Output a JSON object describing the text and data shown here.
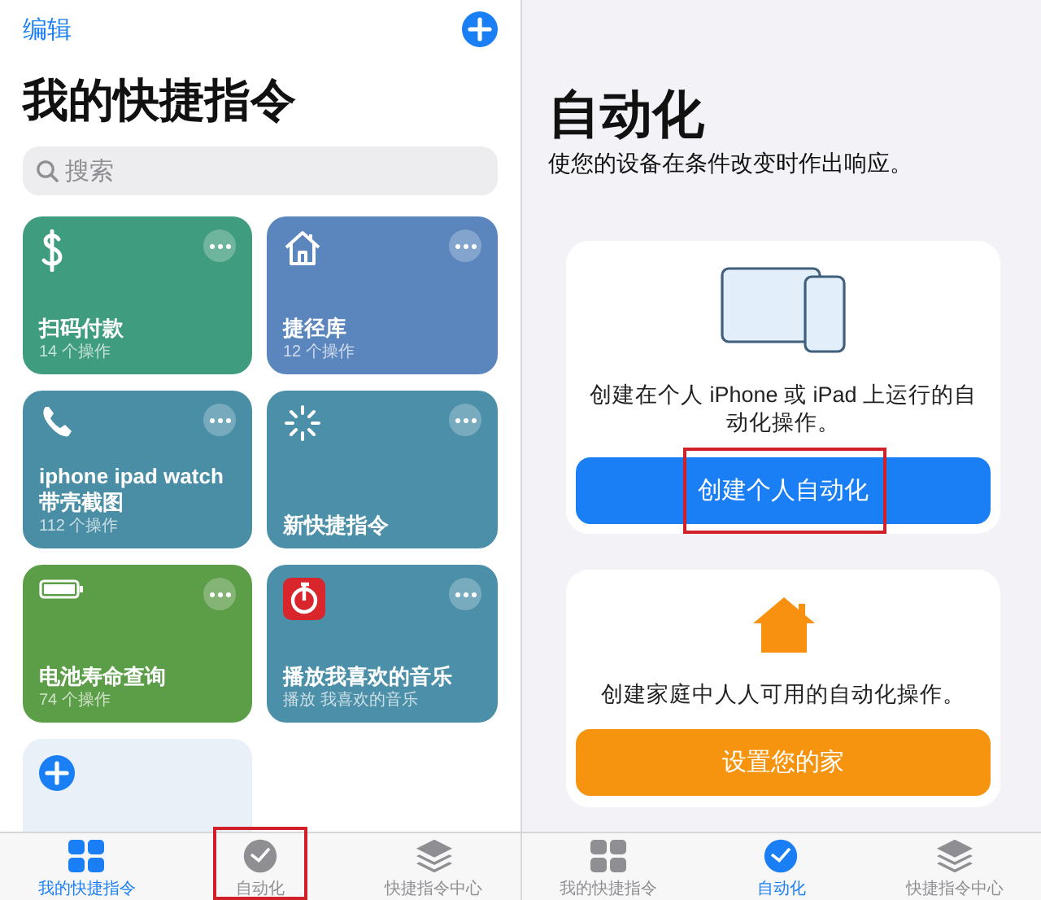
{
  "shortcuts_screen": {
    "edit_link": "编辑",
    "title": "我的快捷指令",
    "search": {
      "placeholder": "搜索"
    },
    "cards": [
      {
        "title": "扫码付款",
        "subtitle": "14 个操作",
        "color": "#3f9c7e"
      },
      {
        "title": "捷径库",
        "subtitle": "12 个操作",
        "color": "#5a86bd"
      },
      {
        "title": "iphone ipad watch 带壳截图",
        "subtitle": "112 个操作",
        "color": "#4a8ea6"
      },
      {
        "title": "新快捷指令",
        "color": "#4c8fa8"
      },
      {
        "title": "电池寿命查询",
        "subtitle": "74 个操作",
        "color": "#5c9d48"
      },
      {
        "title": "播放我喜欢的音乐",
        "subtitle": "播放 我喜欢的音乐",
        "color": "#4c8fa8"
      }
    ],
    "tab_bar": [
      {
        "label": "我的快捷指令",
        "selected": true,
        "highlighted": false
      },
      {
        "label": "自动化",
        "selected": false,
        "highlighted": true
      },
      {
        "label": "快捷指令中心",
        "selected": false,
        "highlighted": false
      }
    ]
  },
  "automation_screen": {
    "title": "自动化",
    "subtitle": "使您的设备在条件改变时作出响应。",
    "cards": [
      {
        "kind": "personal",
        "text": "创建在个人 iPhone 或 iPad 上运行的自动化操作。",
        "button": "创建个人自动化",
        "highlighted": true
      },
      {
        "kind": "home",
        "text": "创建家庭中人人可用的自动化操作。",
        "button": "设置您的家",
        "highlighted": false
      }
    ],
    "tab_bar": [
      {
        "label": "我的快捷指令",
        "selected": false,
        "highlighted": false
      },
      {
        "label": "自动化",
        "selected": true,
        "highlighted": false
      },
      {
        "label": "快捷指令中心",
        "selected": false,
        "highlighted": false
      }
    ]
  }
}
